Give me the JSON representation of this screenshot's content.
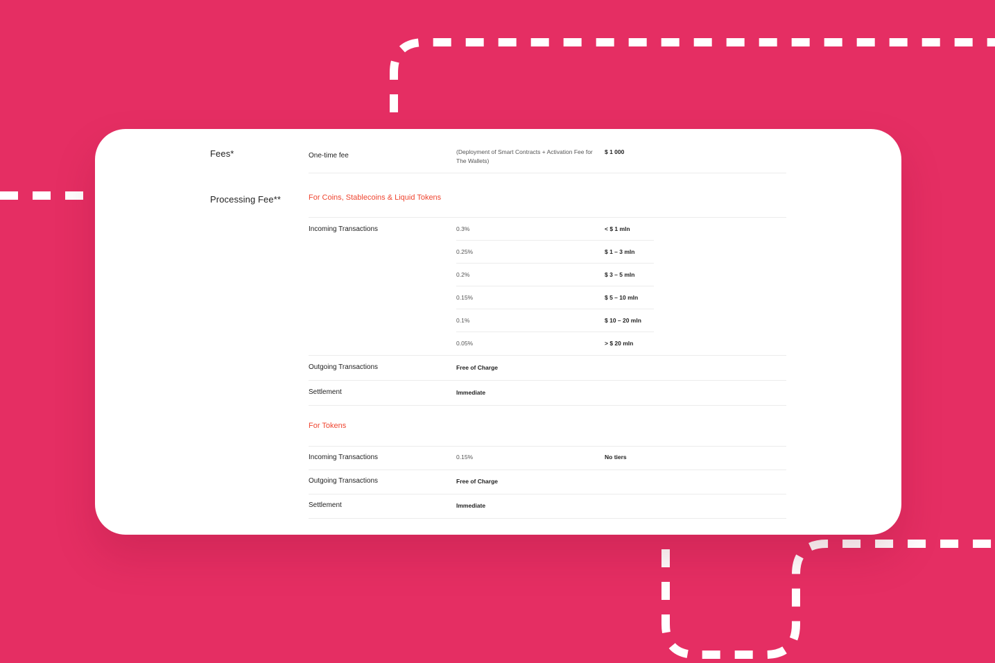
{
  "fees": {
    "label": "Fees*",
    "one_time_label": "One-time fee",
    "one_time_desc": "(Deployment of Smart Contracts + Activation Fee for The Wallets)",
    "one_time_amount": "$ 1 000"
  },
  "processing": {
    "label": "Processing Fee**",
    "coins": {
      "heading": "For Coins,  Stablecoins & Liquid Tokens",
      "incoming_label": "Incoming Transactions",
      "tiers": [
        {
          "rate": "0.3%",
          "volume": "< $ 1 mln"
        },
        {
          "rate": "0.25%",
          "volume": "$ 1 – 3 mln"
        },
        {
          "rate": "0.2%",
          "volume": "$ 3 – 5 mln"
        },
        {
          "rate": "0.15%",
          "volume": "$ 5 – 10 mln"
        },
        {
          "rate": "0.1%",
          "volume": "$ 10 – 20 mln"
        },
        {
          "rate": "0.05%",
          "volume": "> $ 20 mln"
        }
      ],
      "outgoing_label": "Outgoing Transactions",
      "outgoing_value": "Free of Charge",
      "settlement_label": "Settlement",
      "settlement_value": "Immediate"
    },
    "tokens": {
      "heading": "For Tokens",
      "incoming_label": "Incoming Transactions",
      "incoming_rate": "0.15%",
      "incoming_tiers": "No tiers",
      "outgoing_label": "Outgoing Transactions",
      "outgoing_value": "Free of Charge",
      "settlement_label": "Settlement",
      "settlement_value": "Immediate"
    }
  },
  "colors": {
    "background": "#e52e63",
    "card": "#ffffff",
    "accent": "#ef4530",
    "divider": "#ececec"
  }
}
